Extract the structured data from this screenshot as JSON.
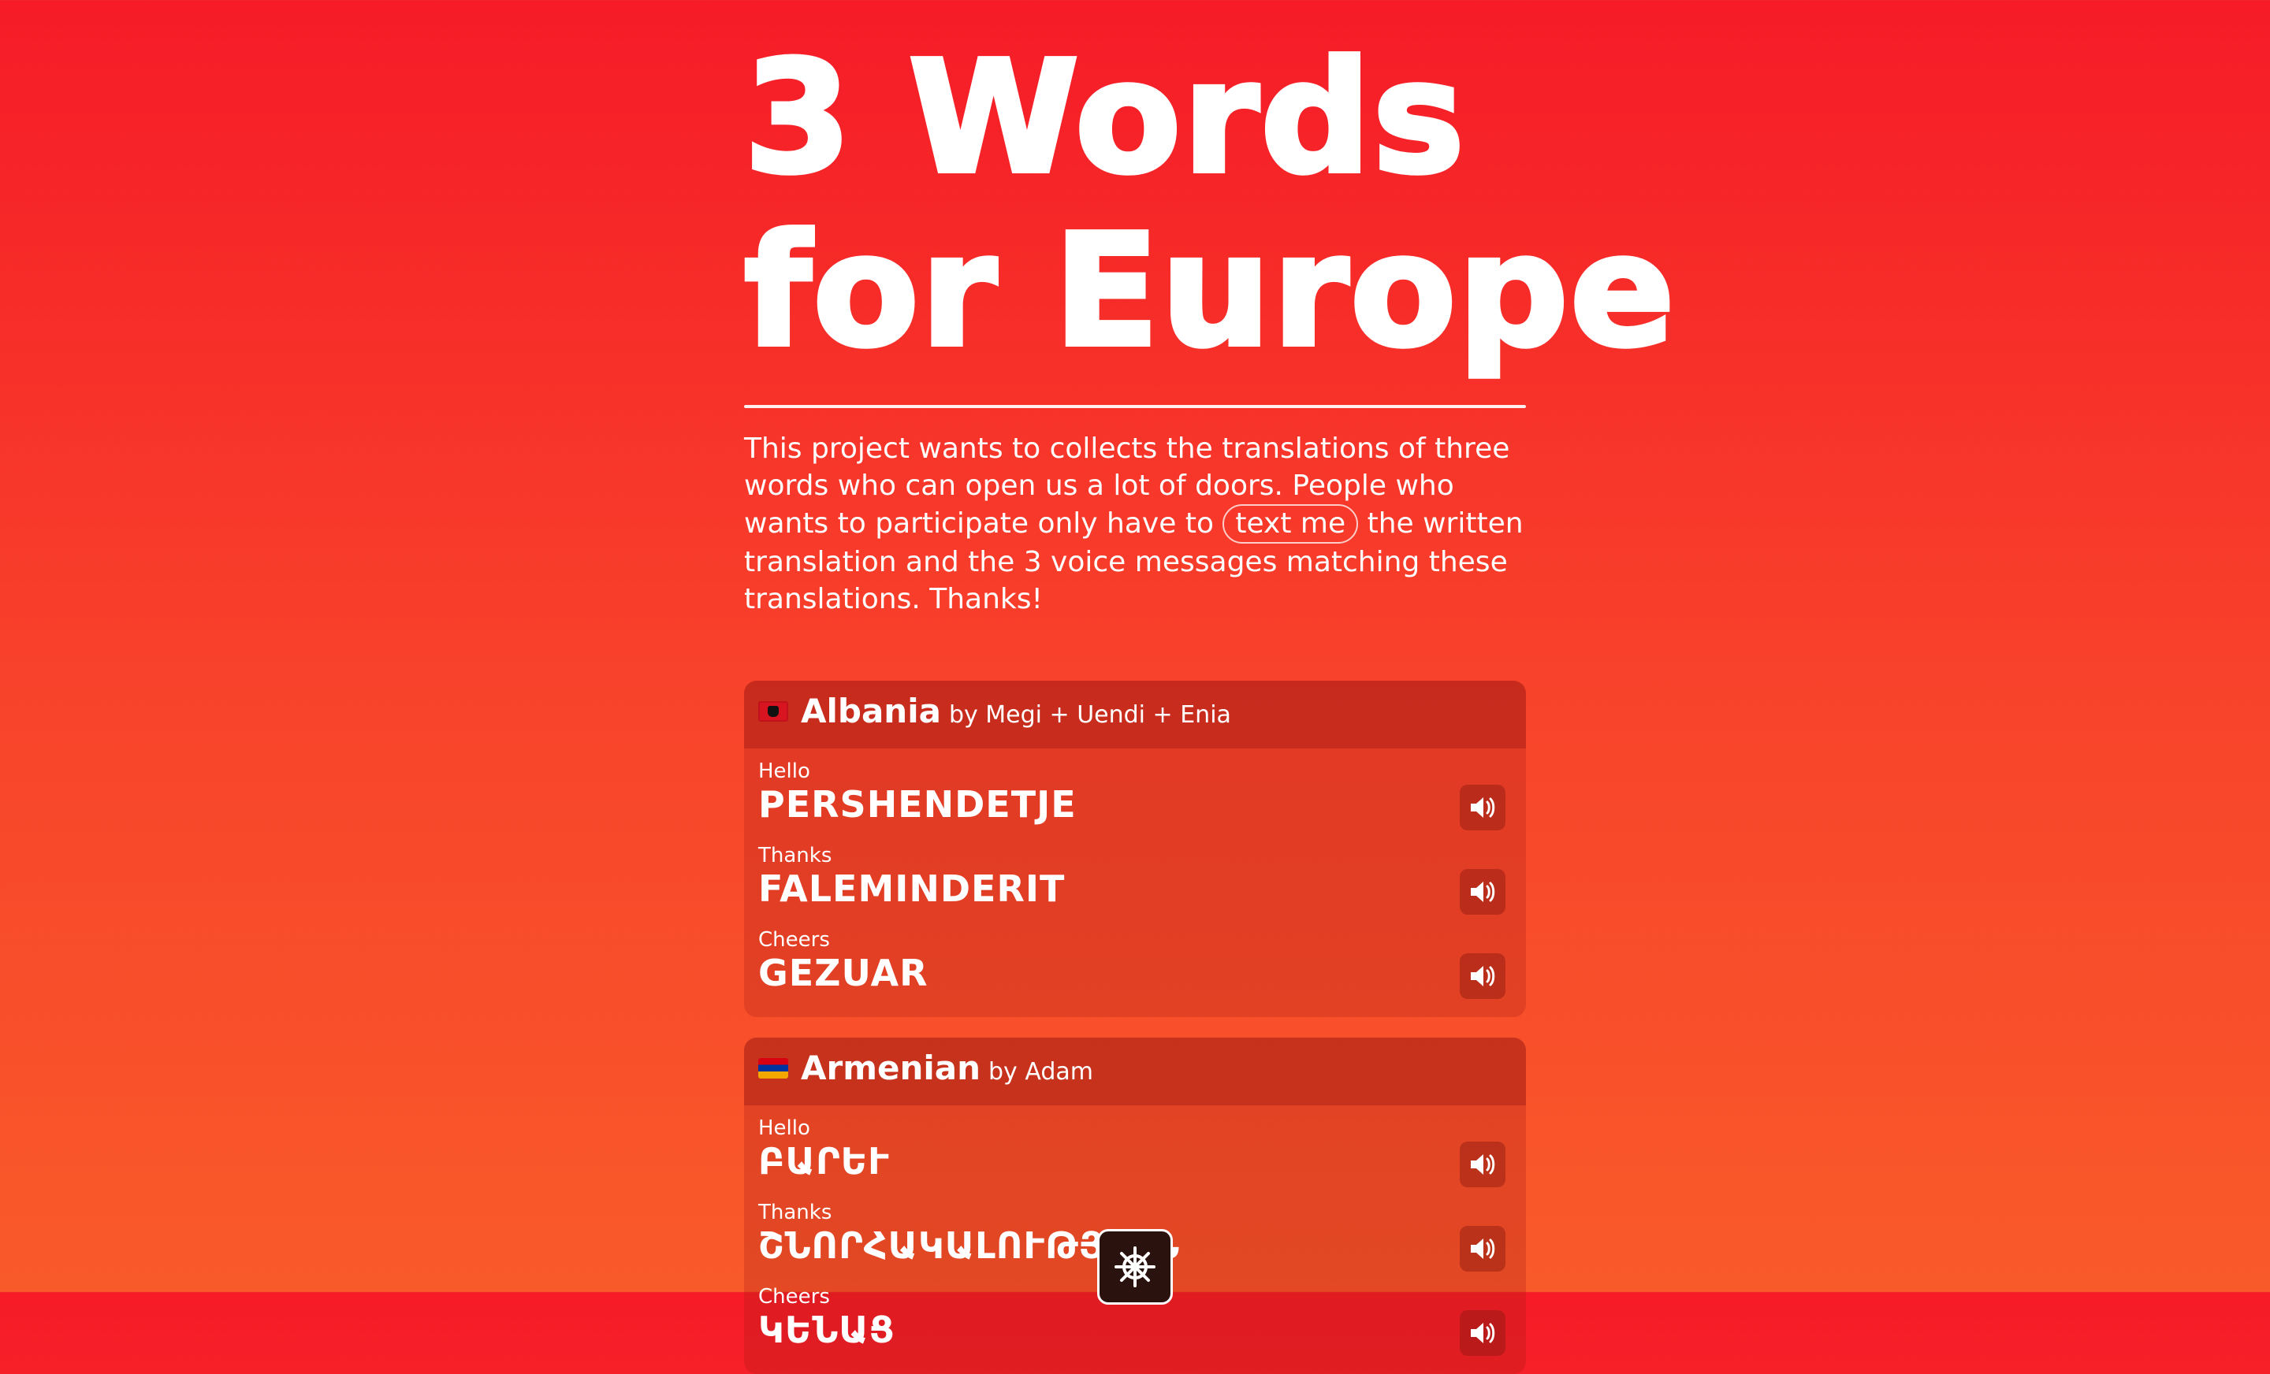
{
  "hero": {
    "title_line1": "3 Words",
    "title_line2": "for Europe"
  },
  "intro": {
    "text_before": "This project wants to collects the translations of three words who can open us a lot of doors. People who wants to participate only have to ",
    "link_label": "text me",
    "text_after": " the written translation and the 3 voice messages matching these translations. Thanks!"
  },
  "cards": [
    {
      "flag": "albania-flag-icon",
      "country": "Albania",
      "by": "by Megi + Uendi + Enia",
      "words": [
        {
          "label": "Hello",
          "value": "PERSHENDETJE"
        },
        {
          "label": "Thanks",
          "value": "FALEMINDERIT"
        },
        {
          "label": "Cheers",
          "value": "GEZUAR"
        }
      ]
    },
    {
      "flag": "armenia-flag-icon",
      "country": "Armenian",
      "by": "by Adam",
      "words": [
        {
          "label": "Hello",
          "value": "ԲԱՐԵՒ"
        },
        {
          "label": "Thanks",
          "value": "ՇՆՈՐՀԱԿԱԼՈՒԹՅՈՒՆ"
        },
        {
          "label": "Cheers",
          "value": "ԿԵՆԱՑ"
        }
      ]
    }
  ],
  "icons": {
    "audio": "speaker-icon",
    "floating": "ship-wheel-icon"
  },
  "colors": {
    "gradient_top": "#f61b27",
    "gradient_bottom": "#f95a2a",
    "text": "#ffffff"
  }
}
